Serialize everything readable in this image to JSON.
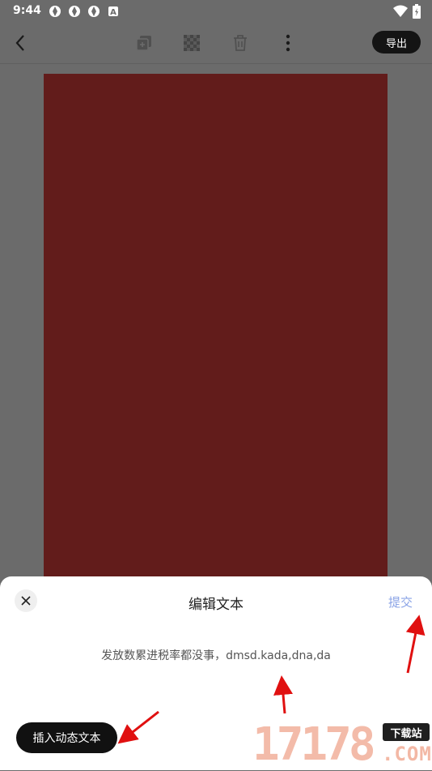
{
  "status_bar": {
    "time": "9:44",
    "notification_icons": [
      "app-notification-icon",
      "app-notification-icon",
      "app-notification-icon",
      "text-notification-icon"
    ],
    "right_icons": [
      "wifi-icon",
      "battery-icon"
    ]
  },
  "toolbar": {
    "back_icon": "chevron-left-icon",
    "action_icons": [
      "duplicate-icon",
      "transparency-icon",
      "delete-icon",
      "more-icon"
    ],
    "export_label": "导出"
  },
  "canvas": {
    "background_color": "#621c1b"
  },
  "editor_sheet": {
    "title": "编辑文本",
    "submit_label": "提交",
    "preview_text": "发放数累进税率都没事，dmsd.kada,dna,da",
    "insert_button_label": "插入动态文本"
  },
  "colors": {
    "submit": "#8aa3e6",
    "annotation": "#e01010",
    "dark_button": "#111111"
  },
  "watermark": {
    "digits": "17178",
    "badge": "下载站",
    "domain": ".COM"
  }
}
